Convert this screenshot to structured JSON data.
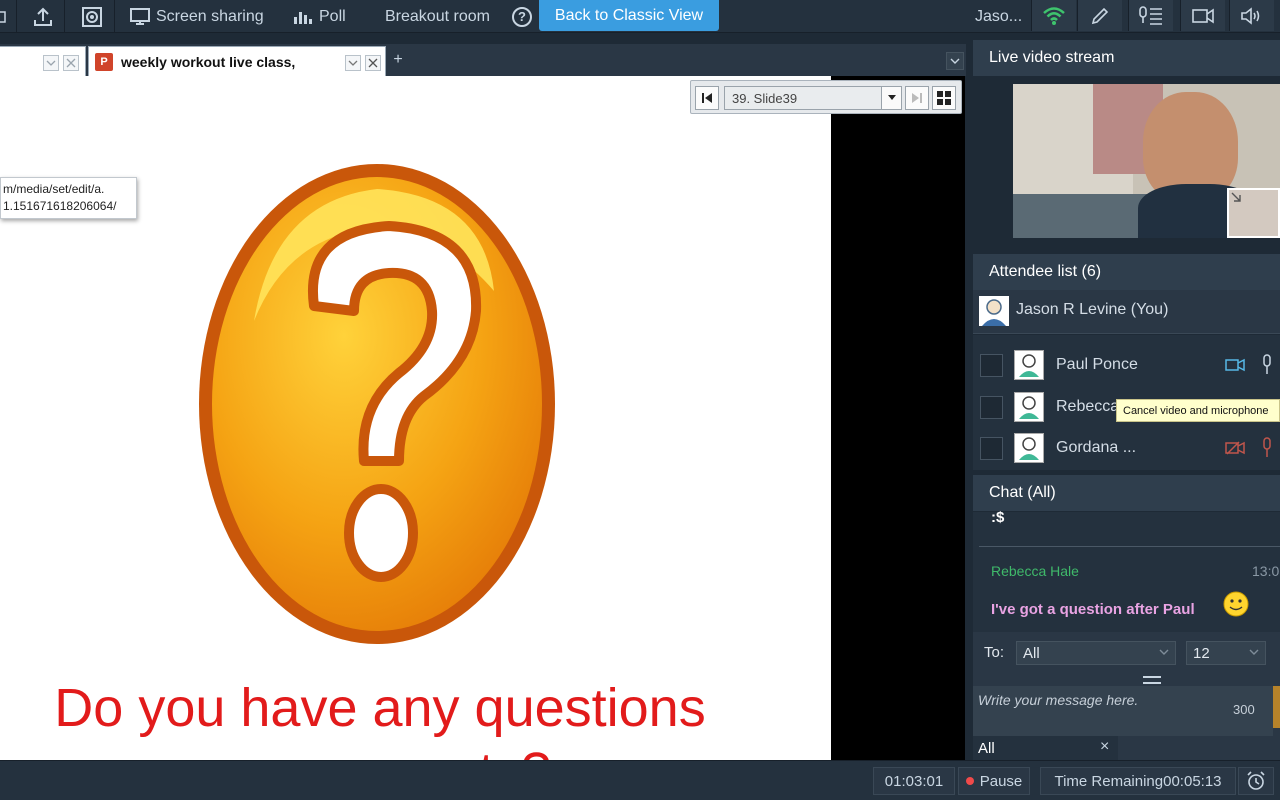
{
  "toolbar": {
    "screen_sharing": "Screen sharing",
    "poll": "Poll",
    "breakout_room": "Breakout room",
    "help": "?",
    "classic_view": "Back to Classic View",
    "user": "Jaso..."
  },
  "tabs": [
    {
      "label": ""
    },
    {
      "label": "weekly workout live class,"
    }
  ],
  "slide": {
    "selected": "39. Slide39",
    "text_line1": "Do you have any questions",
    "text_line2": "or comments?",
    "url_line1": "m/media/set/edit/a.",
    "url_line2": "1.151671618206064/"
  },
  "panels": {
    "video_title": "Live video stream",
    "attendee_title": "Attendee list (6)",
    "chat_title": "Chat (All)"
  },
  "attendees": {
    "host": "Jason R  Levine (You)",
    "list": [
      {
        "name": "Paul Ponce"
      },
      {
        "name": "Rebecca"
      },
      {
        "name": "Gordana ..."
      }
    ],
    "tooltip": "Cancel video and microphone"
  },
  "chat": {
    "previous": ":$",
    "sender": "Rebecca Hale",
    "time": "13:0",
    "message": "I've got a question after Paul",
    "to_label": "To:",
    "to_value": "All",
    "font_size": "12",
    "placeholder": "Write your message here.",
    "char_count": "300",
    "tab_all": "All",
    "tab_close": "×"
  },
  "status": {
    "elapsed": "01:03:01",
    "pause": "Pause",
    "time_remaining_label": "Time Remaining",
    "time_remaining": "00:05:13"
  },
  "colors": {
    "accent": "#3a9de0",
    "chat_sender": "#3fb96a",
    "chat_message": "#e9a3e3",
    "slide_text": "#e21b1b"
  }
}
